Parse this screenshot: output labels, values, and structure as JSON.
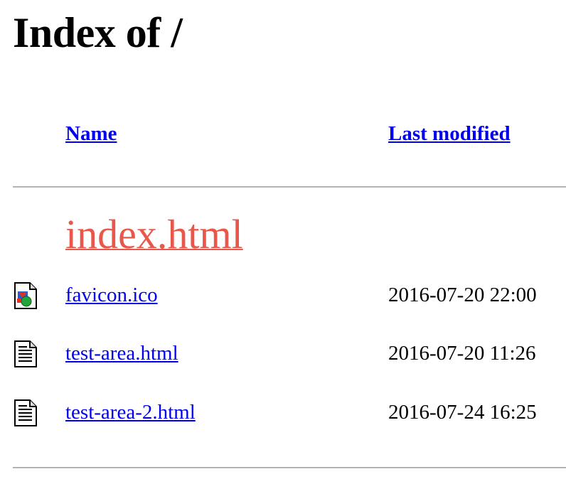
{
  "page": {
    "heading": "Index of /"
  },
  "table": {
    "headers": {
      "name": "Name",
      "last_modified": "Last modified"
    },
    "highlighted_entry": {
      "name": "index.html"
    },
    "rows": [
      {
        "name": "favicon.ico",
        "modified": "2016-07-20 22:00",
        "icon": "image-file-icon"
      },
      {
        "name": "test-area.html",
        "modified": "2016-07-20 11:26",
        "icon": "text-file-icon"
      },
      {
        "name": "test-area-2.html",
        "modified": "2016-07-24 16:25",
        "icon": "text-file-icon"
      }
    ]
  },
  "colors": {
    "link": "#0000ee",
    "highlight": "#e8574a",
    "rule": "#c0c0c0"
  }
}
